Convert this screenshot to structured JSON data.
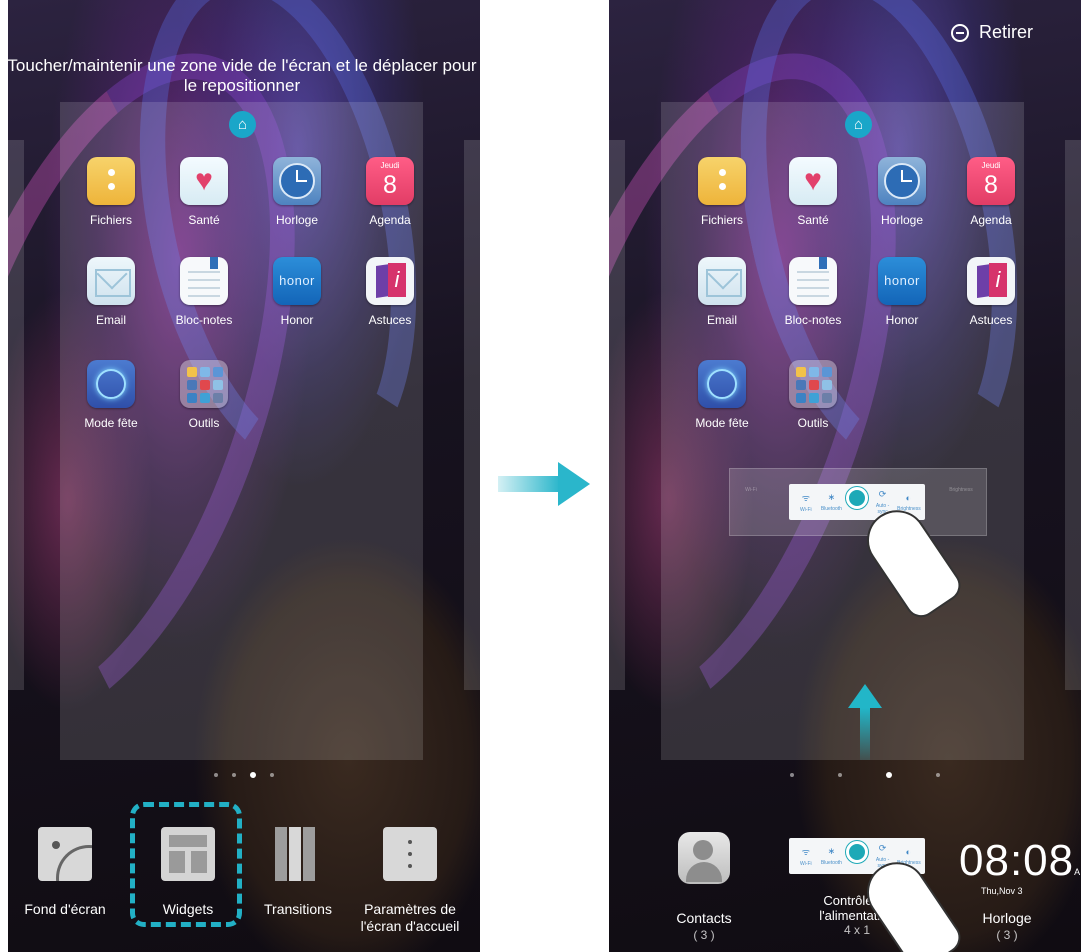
{
  "left_screen": {
    "instruction": "Toucher/maintenir une zone vide de l'écran et le déplacer pour le repositionner",
    "apps": [
      {
        "label": "Fichiers"
      },
      {
        "label": "Santé"
      },
      {
        "label": "Horloge"
      },
      {
        "label": "Agenda"
      },
      {
        "label": "Email"
      },
      {
        "label": "Bloc-notes"
      },
      {
        "label": "Honor"
      },
      {
        "label": "Astuces"
      },
      {
        "label": "Mode fête"
      },
      {
        "label": "Outils"
      }
    ],
    "agenda_icon": {
      "day": "Jeudi",
      "date": "8"
    },
    "honor_icon_text": "honor",
    "bottom_menu": {
      "wallpaper": "Fond d'écran",
      "widgets": "Widgets",
      "transitions": "Transitions",
      "settings": "Paramètres de l'écran d'accueil"
    }
  },
  "right_screen": {
    "retirer": "Retirer",
    "apps": [
      {
        "label": "Fichiers"
      },
      {
        "label": "Santé"
      },
      {
        "label": "Horloge"
      },
      {
        "label": "Agenda"
      },
      {
        "label": "Email"
      },
      {
        "label": "Bloc-notes"
      },
      {
        "label": "Honor"
      },
      {
        "label": "Astuces"
      },
      {
        "label": "Mode fête"
      },
      {
        "label": "Outils"
      }
    ],
    "agenda_icon": {
      "day": "Jeudi",
      "date": "8"
    },
    "honor_icon_text": "honor",
    "widget_items": [
      "Wi-Fi",
      "Bluetooth",
      "",
      "Auto - sync",
      "Brightness"
    ],
    "widget_preview_side": {
      "left": "Wi-Fi",
      "right": "Brightness"
    },
    "bottom_widgets": {
      "contacts": {
        "label": "Contacts",
        "count": "( 3 )"
      },
      "power": {
        "label": "Contrôle de l'alimentation",
        "size": "4 x 1"
      },
      "clock": {
        "label": "Horloge",
        "count": "( 3 )",
        "time": "08:08",
        "ampm": "AM",
        "date": "Thu,Nov 3"
      }
    }
  },
  "colors": {
    "accent": "#22b0c5"
  }
}
